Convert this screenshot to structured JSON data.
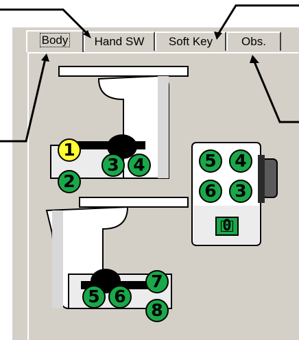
{
  "tabs": [
    {
      "label": "Body",
      "active": true
    },
    {
      "label": "Hand SW",
      "active": false
    },
    {
      "label": "Soft Key",
      "active": false
    },
    {
      "label": "Obs.",
      "active": false
    }
  ],
  "device": {
    "upper": {
      "buttons": [
        "1",
        "2",
        "3",
        "4"
      ]
    },
    "lower": {
      "buttons": [
        "5",
        "6",
        "7",
        "8"
      ]
    },
    "side_panel": {
      "buttons": [
        "5",
        "4",
        "6",
        "3"
      ],
      "key": "0"
    }
  },
  "colors": {
    "button_green": "#1aa84a",
    "button_highlight": "#ffff33",
    "panel": "#d4d0c8"
  }
}
